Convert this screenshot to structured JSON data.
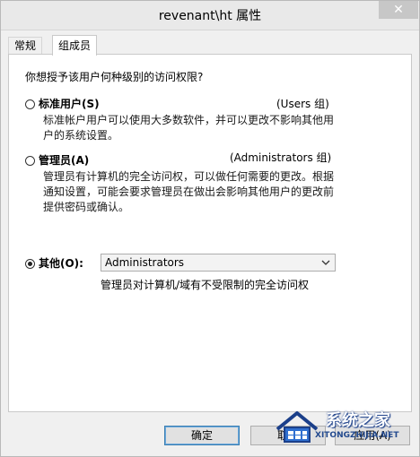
{
  "window": {
    "title": "revenant\\ht 属性",
    "close_glyph": "✕"
  },
  "tabs": [
    {
      "label": "常规",
      "active": false
    },
    {
      "label": "组成员",
      "active": true
    }
  ],
  "main": {
    "question": "你想授予该用户何种级别的访问权限?",
    "options": [
      {
        "label": "标准用户(S)",
        "group": "(Users 组)",
        "checked": false,
        "description": [
          "标准帐户用户可以使用大多数软件，并可以更改不影响其他用",
          "户的系统设置。"
        ]
      },
      {
        "label": "管理员(A)",
        "group": "(Administrators 组)",
        "checked": false,
        "description": [
          "管理员有计算机的完全访问权，可以做任何需要的更改。根据",
          "通知设置，可能会要求管理员在做出会影响其他用户的更改前",
          "提供密码或确认。"
        ]
      },
      {
        "label": "其他(O):",
        "checked": true,
        "select_value": "Administrators",
        "description": "管理员对计算机/域有不受限制的完全访问权"
      }
    ]
  },
  "buttons": {
    "ok": "确定",
    "cancel": "取消",
    "apply": "应用(A)"
  },
  "watermark": {
    "text": "系统之家",
    "url": "XITONGZHIJIA.NET",
    "icon": "house-logo-icon"
  },
  "colors": {
    "panel_bg": "#ffffff",
    "window_bg": "#f0f0f0",
    "button_focus": "#3c7fb1",
    "watermark_blue": "#1b3f8a"
  }
}
